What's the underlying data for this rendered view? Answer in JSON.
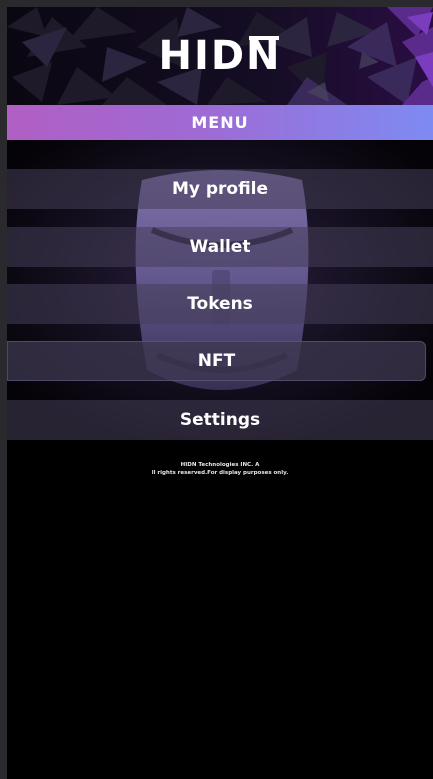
{
  "header": {
    "logo_text": "HIDN",
    "logo_prefix": "HID",
    "logo_last": "N"
  },
  "menu": {
    "title": "MENU",
    "items": [
      {
        "label": "My profile"
      },
      {
        "label": "Wallet"
      },
      {
        "label": "Tokens"
      },
      {
        "label": "NFT",
        "active": true
      },
      {
        "label": "Settings"
      }
    ]
  },
  "footer": {
    "line1": "HIDN Technologies INC. A",
    "line2": "ll rights reserved.For display purposes only."
  },
  "colors": {
    "menu_gradient_start": "#b05fc4",
    "menu_gradient_end": "#7d8bf2",
    "background": "#000000",
    "accent_purple": "#8a4fd8"
  }
}
